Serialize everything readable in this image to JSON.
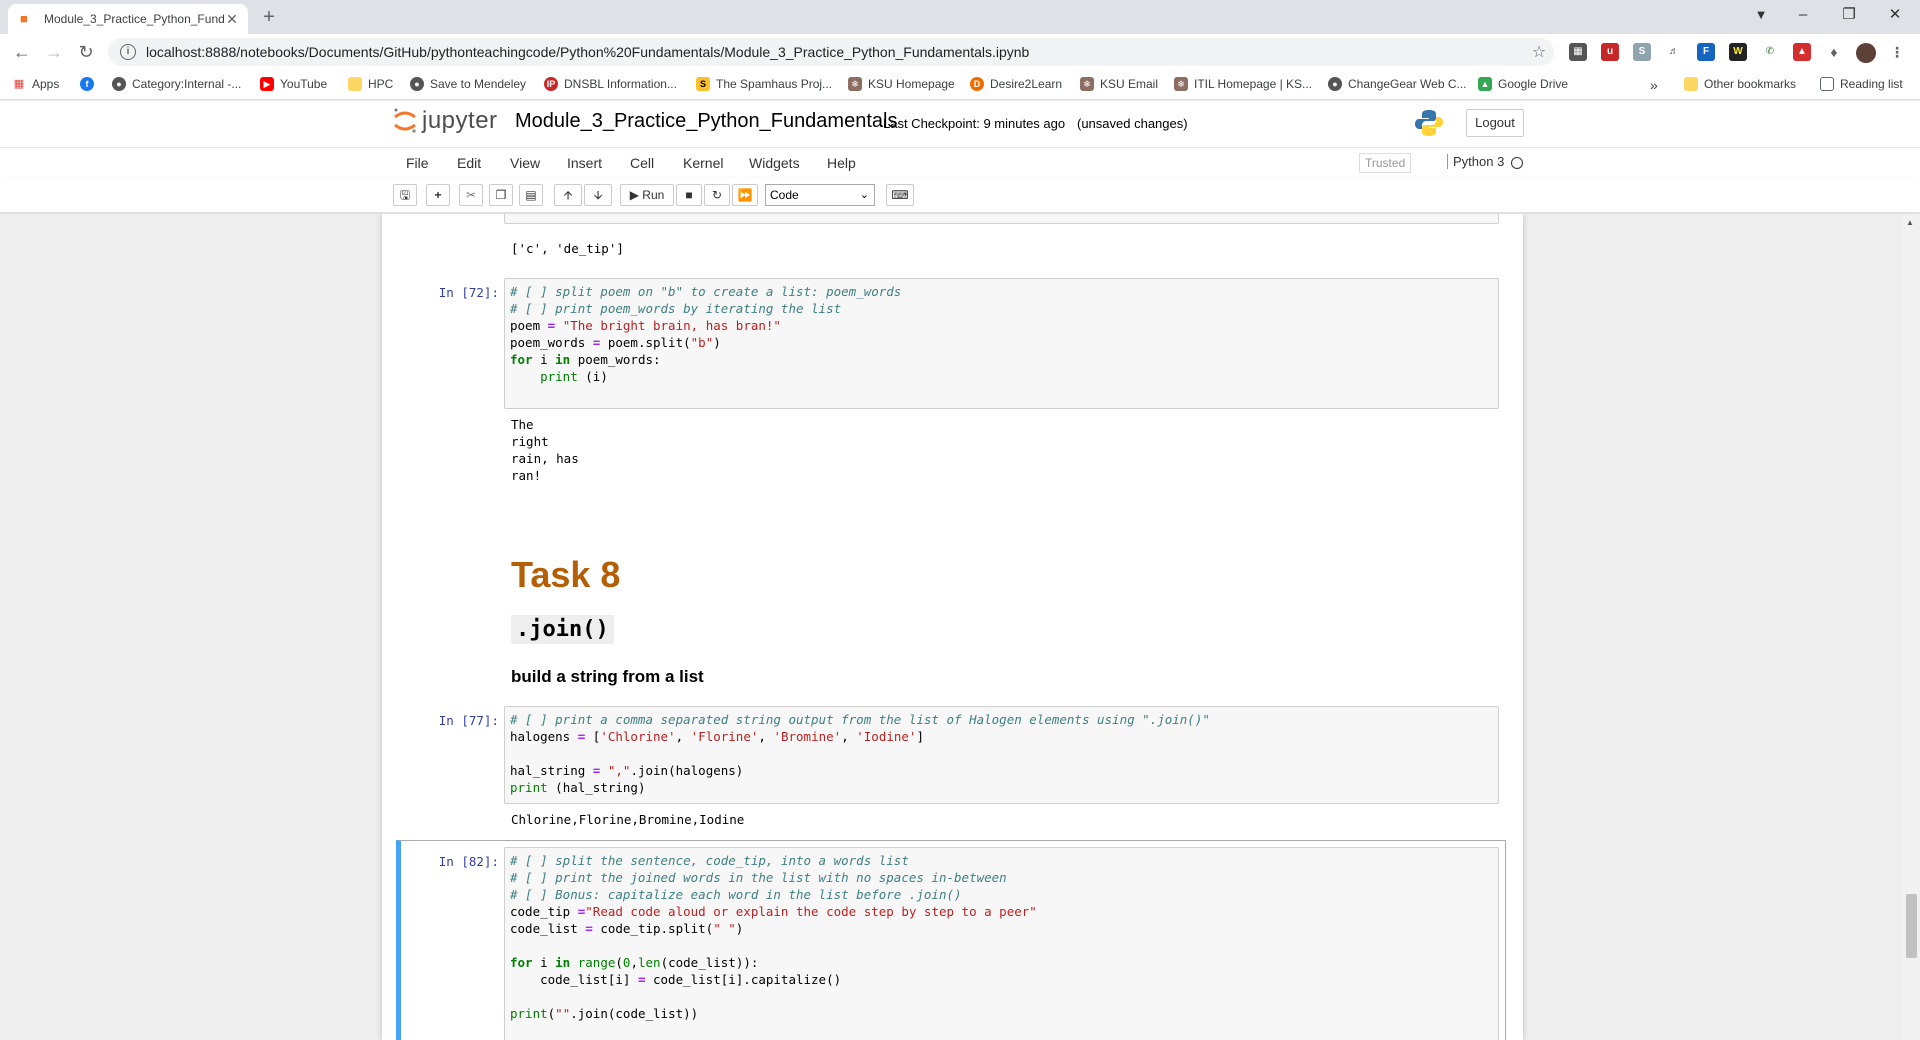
{
  "browser": {
    "tab_title": "Module_3_Practice_Python_Fund...",
    "url": "localhost:8888/notebooks/Documents/GitHub/pythonteachingcode/Python%20Fundamentals/Module_3_Practice_Python_Fundamentals.ipynb",
    "bookmarks": [
      "Apps",
      "Category:Internal -...",
      "YouTube",
      "HPC",
      "Save to Mendeley",
      "DNSBL Information...",
      "The Spamhaus Proj...",
      "KSU Homepage",
      "Desire2Learn",
      "KSU Email",
      "ITIL Homepage | KS...",
      "ChangeGear Web C...",
      "Google Drive"
    ],
    "bookmarks_more": "»",
    "other_bookmarks": "Other bookmarks",
    "reading_list": "Reading list"
  },
  "jupyter": {
    "logo_text": "jupyter",
    "notebook_name": "Module_3_Practice_Python_Fundamentals",
    "checkpoint": "Last Checkpoint: 9 minutes ago",
    "unsaved": "(unsaved changes)",
    "logout": "Logout",
    "menus": [
      "File",
      "Edit",
      "View",
      "Insert",
      "Cell",
      "Kernel",
      "Widgets",
      "Help"
    ],
    "trusted": "Trusted",
    "kernel": "Python 3",
    "run_label": "Run",
    "cell_type": "Code"
  },
  "cells": {
    "top_output": "['c', 'de_tip']",
    "cell72": {
      "prompt": "In [72]:",
      "output": "The\nright\nrain, has\nran!"
    },
    "task_heading": "Task 8",
    "join_code": ".join()",
    "join_sub": "build a string from a list",
    "cell77": {
      "prompt": "In [77]:",
      "output": "Chlorine,Florine,Bromine,Iodine"
    },
    "cell82": {
      "prompt": "In [82]:"
    }
  },
  "colors": {
    "heading": "#b45f06",
    "prompt": "#303f9f",
    "selected_border": "#42a5f5"
  }
}
